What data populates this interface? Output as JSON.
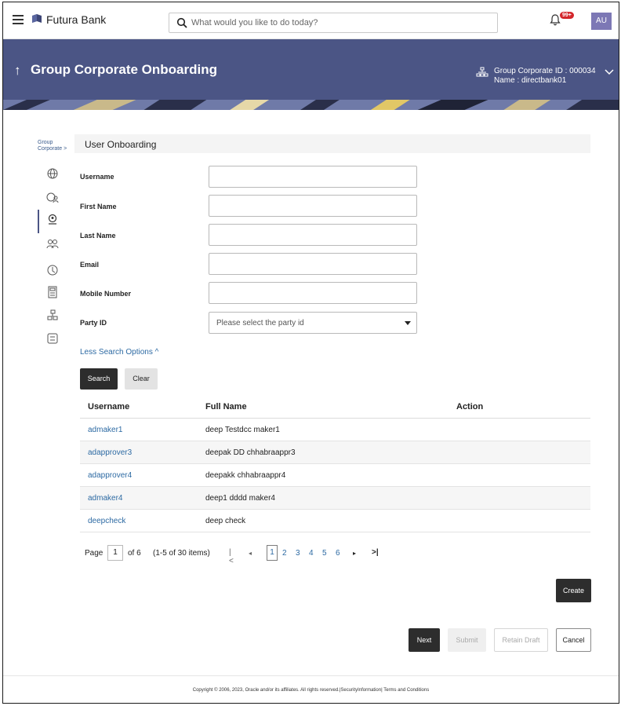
{
  "topbar": {
    "brand": "Futura Bank",
    "search_placeholder": "What would you like to do today?",
    "notification_count": "99+",
    "avatar_initials": "AU",
    "brand_color": "#4b5585"
  },
  "header": {
    "title": "Group Corporate Onboarding",
    "group_corporate_id": "Group Corporate ID : 000034",
    "name": "Name : directbank01"
  },
  "sidebar": {
    "breadcrumb_line1": "Group",
    "breadcrumb_line2": "Corporate >",
    "icons": [
      "globe-icon",
      "users-globe-icon",
      "user-onboarding-icon",
      "user-group-icon",
      "account-icon",
      "calculator-icon",
      "hierarchy-icon",
      "workflow-icon"
    ]
  },
  "form": {
    "section_title": "User Onboarding",
    "username_label": "Username",
    "first_name_label": "First Name",
    "last_name_label": "Last Name",
    "email_label": "Email",
    "mobile_label": "Mobile Number",
    "party_id_label": "Party ID",
    "party_id_placeholder": "Please select the party id",
    "less_search": "Less Search Options ^",
    "search_btn": "Search",
    "clear_btn": "Clear"
  },
  "table": {
    "headers": [
      "Username",
      "Full Name",
      "Action"
    ],
    "rows": [
      {
        "username": "admaker1",
        "full_name": "deep Testdcc maker1"
      },
      {
        "username": "adapprover3",
        "full_name": "deepak DD chhabraappr3"
      },
      {
        "username": "adapprover4",
        "full_name": "deepakk chhabraappr4"
      },
      {
        "username": "admaker4",
        "full_name": "deep1 dddd maker4"
      },
      {
        "username": "deepcheck",
        "full_name": "deep check"
      }
    ]
  },
  "pagination": {
    "page_label": "Page",
    "current_page": "1",
    "of_pages": "of 6",
    "items": "(1-5 of 30 items)",
    "pages": [
      "1",
      "2",
      "3",
      "4",
      "5",
      "6"
    ]
  },
  "actions": {
    "create": "Create",
    "next": "Next",
    "submit": "Submit",
    "retain_draft": "Retain Draft",
    "cancel": "Cancel"
  },
  "footer": {
    "copyright": "Copyright © 2006, 2023, Oracle and/or its affiliates. All rights reserved.|SecurityInformation| Terms and Conditions"
  }
}
